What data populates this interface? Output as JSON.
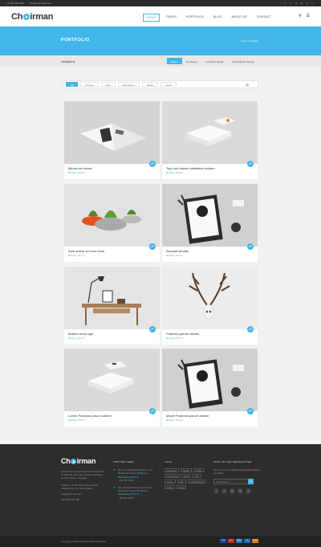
{
  "topbar": {
    "phone": "+1 800 408 9347",
    "email": "info@chairmant.com",
    "social_icons": [
      "facebook-icon",
      "twitter-icon",
      "google-plus-icon",
      "linkedin-icon",
      "pinterest-icon",
      "rss-icon"
    ]
  },
  "header": {
    "logo_pre": "Ch",
    "logo_post": "irman",
    "nav": [
      "HOME",
      "PAGES",
      "PORTFOLIO",
      "BLOG",
      "ABOUT US",
      "CONTACT"
    ],
    "nav_active_index": 0
  },
  "banner": {
    "title": "PORTFOLIO",
    "breadcrumb": "Home  /  Portfolio"
  },
  "subbar": {
    "title": "Variations",
    "tabs": [
      "Margin",
      "No Margin",
      "Full Width Margin",
      "Full Width No Margin"
    ],
    "active_index": 0
  },
  "filters": {
    "items": [
      "All",
      "Printing",
      "Web",
      "Illustrations",
      "Media",
      "Crafts"
    ],
    "active_index": 0
  },
  "cards": [
    {
      "title": "Mirum est notare",
      "meta": "Branding  /  Print Art",
      "scene": "magazine"
    },
    {
      "title": "Typi non habent claritatem insitam",
      "meta": "Branding  /  Print Art",
      "scene": "cards"
    },
    {
      "title": "Duis autem vel eum iriure",
      "meta": "Branding  /  Print Art",
      "scene": "plants"
    },
    {
      "title": "Suscipit lobortis",
      "meta": "Branding  /  Print Art",
      "scene": "clipboard"
    },
    {
      "title": "Bodem modo typi",
      "meta": "Branding  /  Print Art",
      "scene": "desk"
    },
    {
      "title": "Putamus parum claram",
      "meta": "Branding  /  Print Art",
      "scene": "antlers"
    },
    {
      "title": "Lorem Putamus parum claram",
      "meta": "Branding  /  Print Art",
      "scene": "cards"
    },
    {
      "title": "Ipsum Putamus parum claram",
      "meta": "Branding  /  Print Art",
      "scene": "clipboard"
    }
  ],
  "footer": {
    "logo_pre": "Ch",
    "logo_post": "irman",
    "about": "Duis autem vel eum iriure dolor in hendrerit in vulputate velit esse molestie consequat, vel illum dolore eu feugiat.",
    "address": "Address : No 96 Ocean Street 12103 Weather City, NY, United States",
    "email": "info@chairmant.com",
    "phone": "(012) 800 456 789",
    "twitter_heading": "TWITTER FEED",
    "tweets": [
      {
        "text": "We need 8 #infoboxes show a new Wordpress Theme ",
        "link": "#Chairman #Webdesign #Theme",
        "time": "- JUN 05, 2013 -"
      },
      {
        "text": "We need 8 #infoboxes show a new Wordpress Theme ",
        "link": "#Chairman #Webdesign #Theme",
        "time": "- JUN 05, 2013 -"
      }
    ],
    "tags_heading": "TAGS",
    "tags": [
      "Wordpress",
      "MEDIA",
      "CODE",
      "Ecommerce",
      "CSS",
      "PHP",
      "articles",
      "jobs",
      "Portfolio Books",
      "Media",
      "Demo"
    ],
    "newsletter_heading": "SIGN UP FOR NEWSLETTER",
    "newsletter_text": "Sign up for our newsletter to get latest updates and offers.",
    "newsletter_placeholder": "Email address...",
    "socials": [
      "f",
      "t",
      "g+",
      "in",
      "p"
    ],
    "copyright": "Copyright © BeautyParty All Rights Reserved",
    "payments": [
      "VISA",
      "MC",
      "AMEX",
      "PP",
      "DISC"
    ]
  }
}
